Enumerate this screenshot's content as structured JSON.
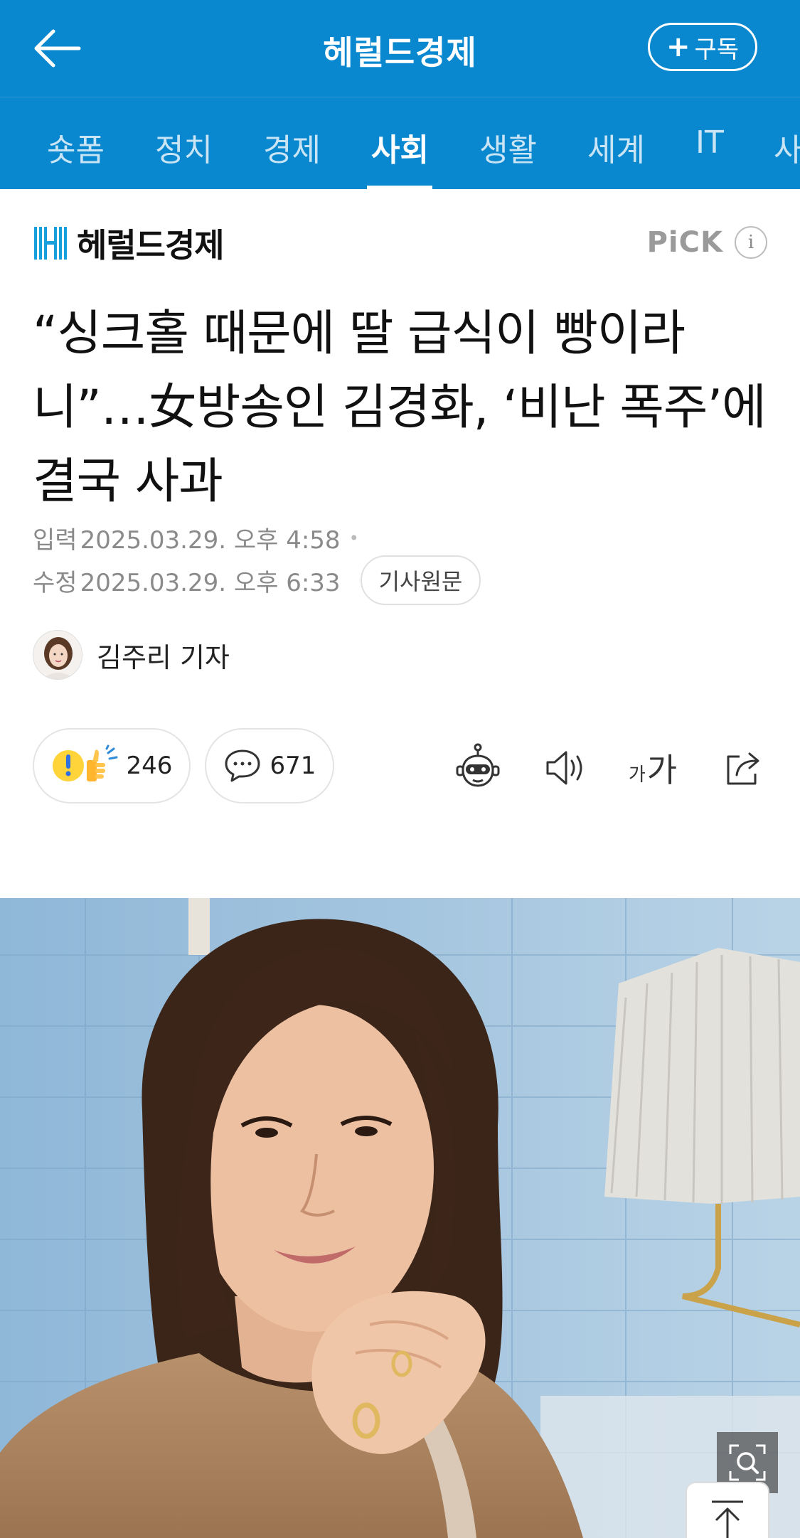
{
  "topbar": {
    "title": "헤럴드경제",
    "subscribe_label": "구독",
    "background_color": "#0a88cf"
  },
  "tabs": [
    {
      "label": "숏폼",
      "active": false
    },
    {
      "label": "정치",
      "active": false
    },
    {
      "label": "경제",
      "active": false
    },
    {
      "label": "사회",
      "active": true
    },
    {
      "label": "생활",
      "active": false
    },
    {
      "label": "세계",
      "active": false
    },
    {
      "label": "IT",
      "active": false
    },
    {
      "label": "사",
      "active": false
    }
  ],
  "press": {
    "name": "헤럴드경제",
    "pick_label": "PiCK",
    "info_icon": "info-icon"
  },
  "article": {
    "headline": "“싱크홀 때문에 딸 급식이 빵이라니”…女방송인 김경화, ‘비난 폭주’에 결국 사과",
    "input_label": "입력",
    "input_time": "2025.03.29. 오후 4:58",
    "edit_label": "수정",
    "edit_time": "2025.03.29. 오후 6:33",
    "original_button": "기사원문",
    "reporter": "김주리 기자"
  },
  "reactions": {
    "like_count": "246",
    "comment_count": "671"
  },
  "tools": [
    "robot-summary-icon",
    "speaker-icon",
    "font-size-icon",
    "share-icon"
  ],
  "font_size_small": "가",
  "font_size_large": "가"
}
